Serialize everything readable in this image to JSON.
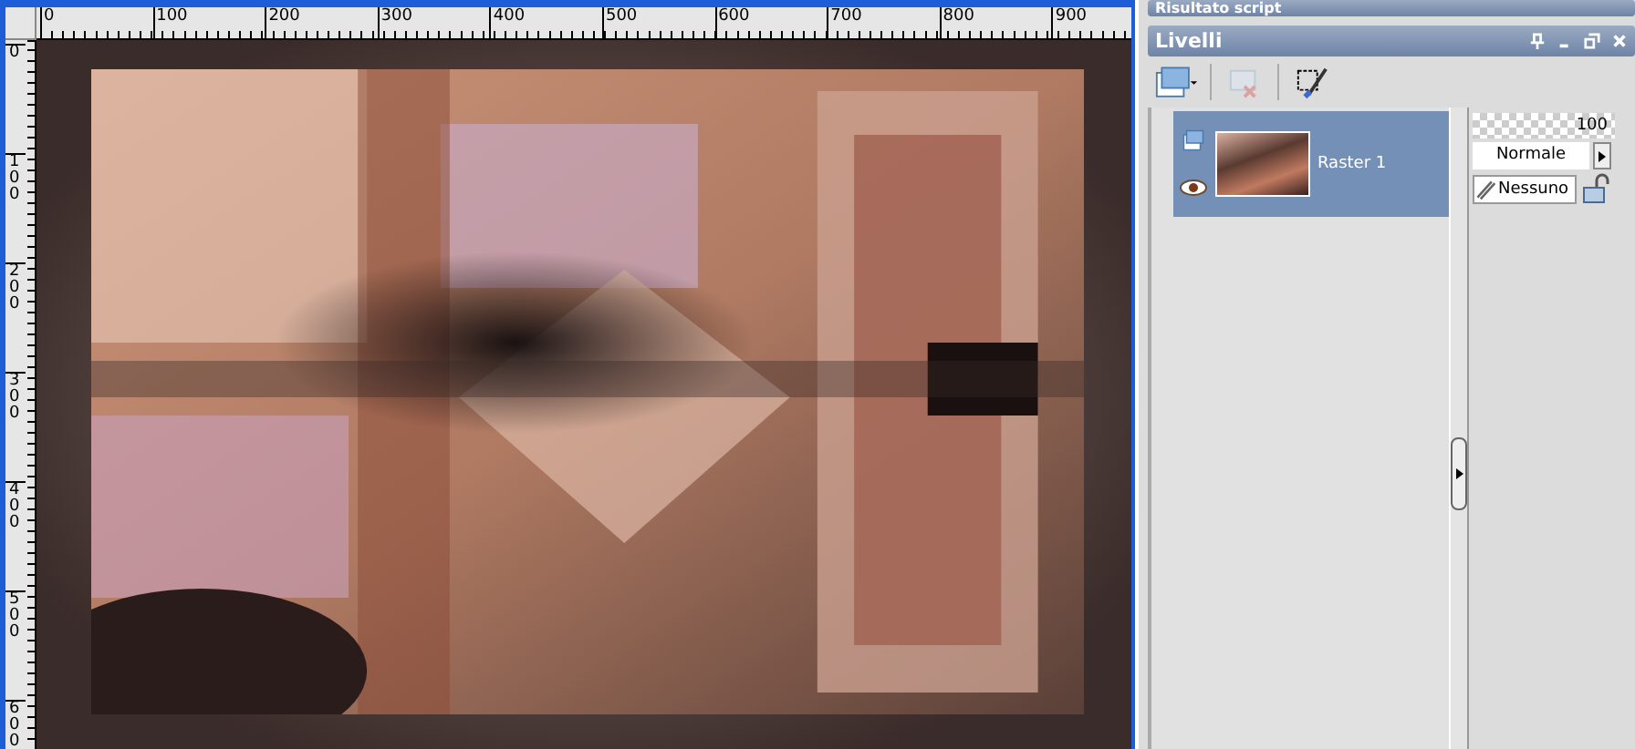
{
  "rulers": {
    "top_labels": [
      "0",
      "100",
      "200",
      "300",
      "400",
      "500",
      "600",
      "700",
      "800",
      "900"
    ],
    "left_labels": [
      "0",
      "100",
      "200",
      "300",
      "400",
      "500",
      "600"
    ]
  },
  "script_panel": {
    "title": "Risultato script"
  },
  "layers_panel": {
    "title": "Livelli",
    "layers": [
      {
        "name": "Raster 1",
        "selected": true,
        "visible": true
      }
    ],
    "opacity": "100",
    "blend_mode": "Normale",
    "mask": "Nessuno"
  }
}
